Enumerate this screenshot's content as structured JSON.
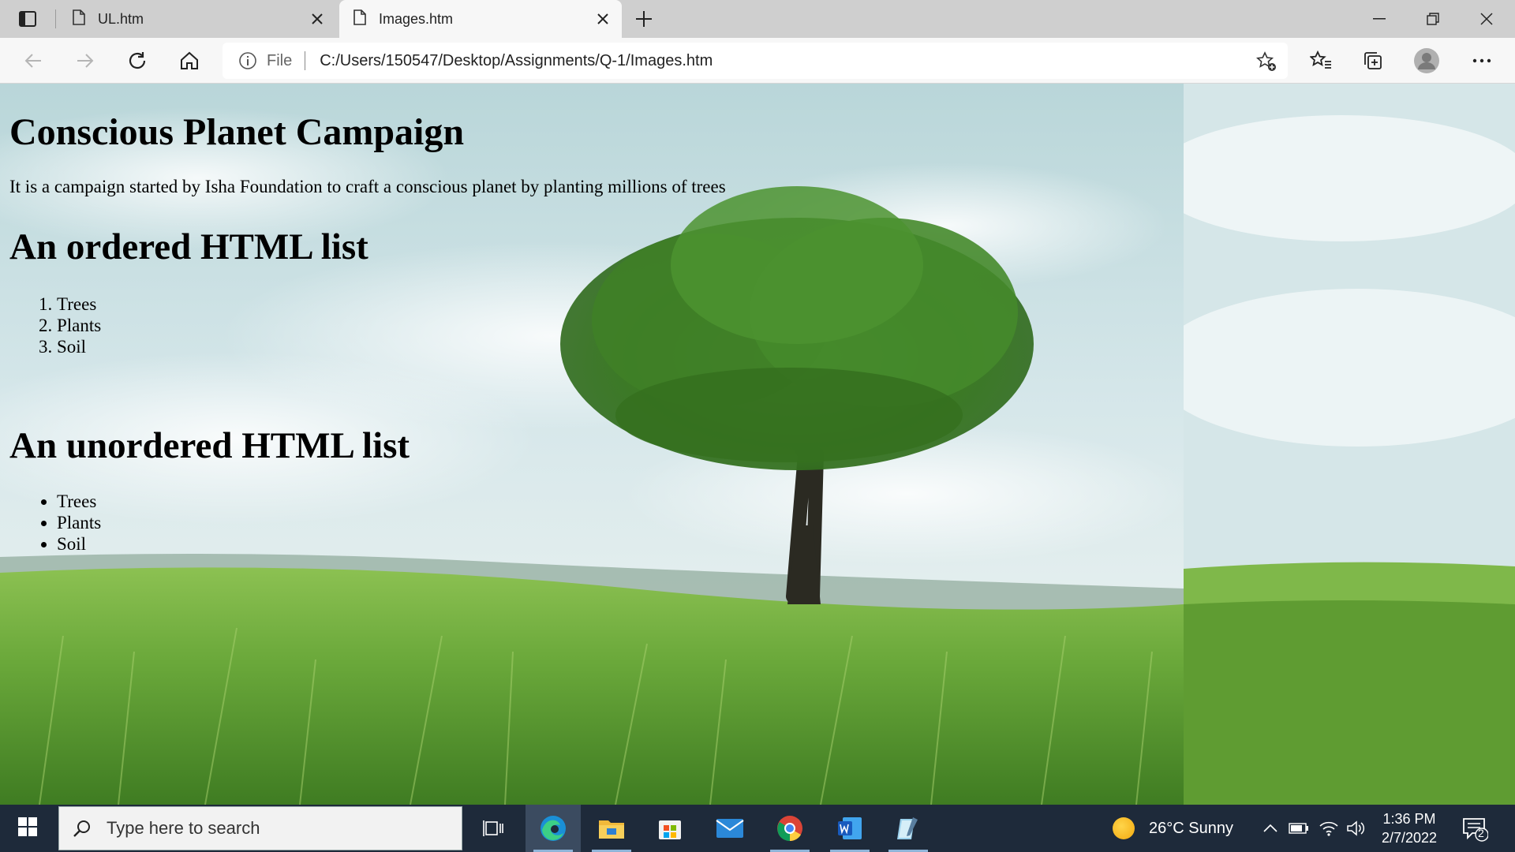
{
  "browser": {
    "tabs": [
      {
        "title": "UL.htm",
        "active": false
      },
      {
        "title": "Images.htm",
        "active": true
      }
    ],
    "address": {
      "scheme_label": "File",
      "url": "C:/Users/150547/Desktop/Assignments/Q-1/Images.htm"
    }
  },
  "page": {
    "title": "Conscious Planet Campaign",
    "intro": "It is a campaign started by Isha Foundation to craft a conscious planet by planting millions of trees",
    "ordered_heading": "An ordered HTML list",
    "ordered_items": [
      "Trees",
      "Plants",
      "Soil"
    ],
    "unordered_heading": "An unordered HTML list",
    "unordered_items": [
      "Trees",
      "Plants",
      "Soil"
    ]
  },
  "taskbar": {
    "search_placeholder": "Type here to search",
    "weather": "26°C  Sunny",
    "time": "1:36 PM",
    "date": "2/7/2022",
    "notification_count": "2",
    "apps": [
      "task-view",
      "edge",
      "file-explorer",
      "microsoft-store",
      "mail",
      "chrome",
      "word",
      "notepad"
    ]
  },
  "colors": {
    "tab_strip": "#cfcfcf",
    "toolbar": "#f7f7f7",
    "taskbar": "#1e2a3a",
    "sky": "#c9dfe3",
    "grass": "#6ea83a"
  }
}
